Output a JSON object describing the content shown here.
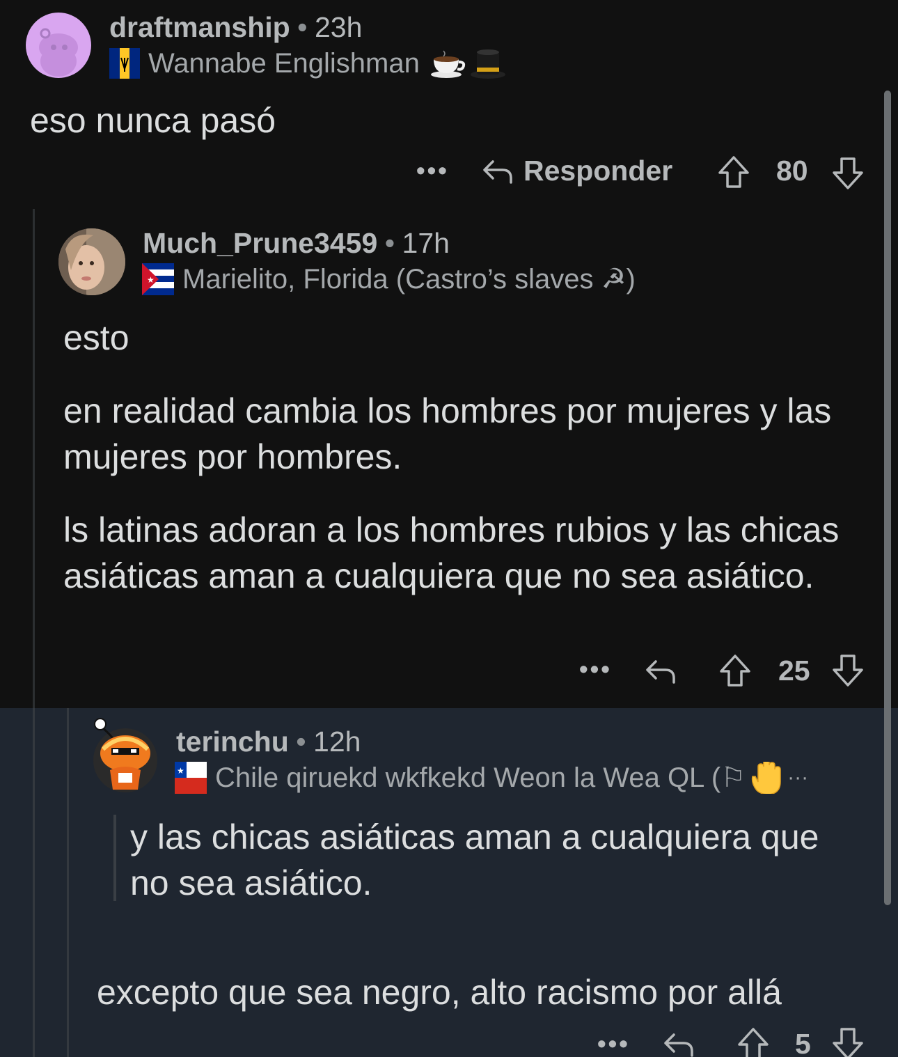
{
  "colors": {
    "background": "#111111",
    "highlight_background": "#1f2630",
    "text_primary": "#dcdedf",
    "text_secondary": "#b6b9bb",
    "avatar_lavender": "#d9a6f0"
  },
  "comment1": {
    "username": "draftmanship",
    "time": "23h",
    "flair": "Wannabe Englishman",
    "flair_icons": [
      "barbados-flag-icon",
      "tea-cup-icon",
      "top-hat-icon"
    ],
    "body": "eso nunca pasó",
    "reply_label": "Responder",
    "score": "80"
  },
  "comment2": {
    "username": "Much_Prune3459",
    "time": "17h",
    "flair": "Marielito, Florida (Castro’s slaves ☭)",
    "flair_icons": [
      "cuba-flag-icon"
    ],
    "paragraphs": [
      "esto",
      "en realidad cambia los hombres por mujeres y las mujeres por hombres.",
      "ls latinas adoran a los hombres rubios y las chicas asiáticas aman a cualquiera que no sea asiático."
    ],
    "score": "25"
  },
  "comment3": {
    "username": "terinchu",
    "time": "12h",
    "flair": "Chile qiruekd wkfkekd Weon la Wea QL (⚐",
    "flair_more": "···",
    "flair_icons": [
      "chile-flag-icon",
      "raised-hand-icon"
    ],
    "quote": "y las chicas asiáticas aman a cualquiera que no sea asiático.",
    "body": "excepto que sea negro, alto racismo por allá",
    "score": "5"
  },
  "separator": "•",
  "more_label": "•••"
}
